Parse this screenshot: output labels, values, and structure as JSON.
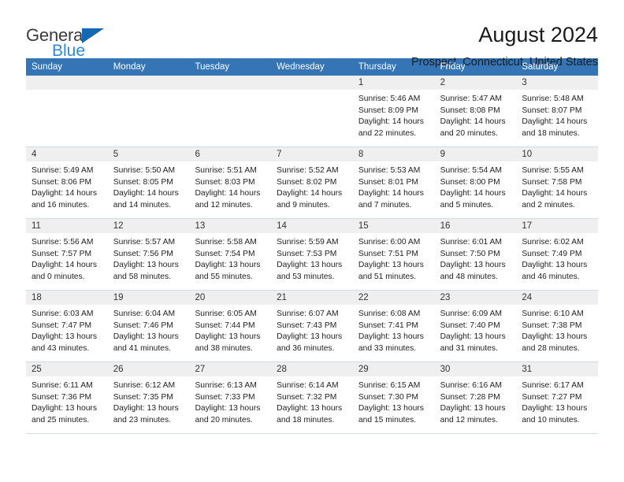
{
  "brand": {
    "name_part1": "General",
    "name_part2": "Blue"
  },
  "header": {
    "title": "August 2024",
    "subtitle": "Prospect, Connecticut, United States"
  },
  "weekday_headers": [
    "Sunday",
    "Monday",
    "Tuesday",
    "Wednesday",
    "Thursday",
    "Friday",
    "Saturday"
  ],
  "colors": {
    "header_blue": "#3575b6",
    "brand_blue": "#2e8ad6",
    "triangle_blue": "#1268b3",
    "daynum_band": "#efefef",
    "grid_line": "#cfdcea"
  },
  "labels": {
    "sunrise_prefix": "Sunrise: ",
    "sunset_prefix": "Sunset: ",
    "daylight_prefix": "Daylight: "
  },
  "weeks": [
    [
      {
        "day": "",
        "empty": true
      },
      {
        "day": "",
        "empty": true
      },
      {
        "day": "",
        "empty": true
      },
      {
        "day": "",
        "empty": true
      },
      {
        "day": "1",
        "sunrise": "Sunrise: 5:46 AM",
        "sunset": "Sunset: 8:09 PM",
        "daylight1": "Daylight: 14 hours",
        "daylight2": "and 22 minutes."
      },
      {
        "day": "2",
        "sunrise": "Sunrise: 5:47 AM",
        "sunset": "Sunset: 8:08 PM",
        "daylight1": "Daylight: 14 hours",
        "daylight2": "and 20 minutes."
      },
      {
        "day": "3",
        "sunrise": "Sunrise: 5:48 AM",
        "sunset": "Sunset: 8:07 PM",
        "daylight1": "Daylight: 14 hours",
        "daylight2": "and 18 minutes."
      }
    ],
    [
      {
        "day": "4",
        "sunrise": "Sunrise: 5:49 AM",
        "sunset": "Sunset: 8:06 PM",
        "daylight1": "Daylight: 14 hours",
        "daylight2": "and 16 minutes."
      },
      {
        "day": "5",
        "sunrise": "Sunrise: 5:50 AM",
        "sunset": "Sunset: 8:05 PM",
        "daylight1": "Daylight: 14 hours",
        "daylight2": "and 14 minutes."
      },
      {
        "day": "6",
        "sunrise": "Sunrise: 5:51 AM",
        "sunset": "Sunset: 8:03 PM",
        "daylight1": "Daylight: 14 hours",
        "daylight2": "and 12 minutes."
      },
      {
        "day": "7",
        "sunrise": "Sunrise: 5:52 AM",
        "sunset": "Sunset: 8:02 PM",
        "daylight1": "Daylight: 14 hours",
        "daylight2": "and 9 minutes."
      },
      {
        "day": "8",
        "sunrise": "Sunrise: 5:53 AM",
        "sunset": "Sunset: 8:01 PM",
        "daylight1": "Daylight: 14 hours",
        "daylight2": "and 7 minutes."
      },
      {
        "day": "9",
        "sunrise": "Sunrise: 5:54 AM",
        "sunset": "Sunset: 8:00 PM",
        "daylight1": "Daylight: 14 hours",
        "daylight2": "and 5 minutes."
      },
      {
        "day": "10",
        "sunrise": "Sunrise: 5:55 AM",
        "sunset": "Sunset: 7:58 PM",
        "daylight1": "Daylight: 14 hours",
        "daylight2": "and 2 minutes."
      }
    ],
    [
      {
        "day": "11",
        "sunrise": "Sunrise: 5:56 AM",
        "sunset": "Sunset: 7:57 PM",
        "daylight1": "Daylight: 14 hours",
        "daylight2": "and 0 minutes."
      },
      {
        "day": "12",
        "sunrise": "Sunrise: 5:57 AM",
        "sunset": "Sunset: 7:56 PM",
        "daylight1": "Daylight: 13 hours",
        "daylight2": "and 58 minutes."
      },
      {
        "day": "13",
        "sunrise": "Sunrise: 5:58 AM",
        "sunset": "Sunset: 7:54 PM",
        "daylight1": "Daylight: 13 hours",
        "daylight2": "and 55 minutes."
      },
      {
        "day": "14",
        "sunrise": "Sunrise: 5:59 AM",
        "sunset": "Sunset: 7:53 PM",
        "daylight1": "Daylight: 13 hours",
        "daylight2": "and 53 minutes."
      },
      {
        "day": "15",
        "sunrise": "Sunrise: 6:00 AM",
        "sunset": "Sunset: 7:51 PM",
        "daylight1": "Daylight: 13 hours",
        "daylight2": "and 51 minutes."
      },
      {
        "day": "16",
        "sunrise": "Sunrise: 6:01 AM",
        "sunset": "Sunset: 7:50 PM",
        "daylight1": "Daylight: 13 hours",
        "daylight2": "and 48 minutes."
      },
      {
        "day": "17",
        "sunrise": "Sunrise: 6:02 AM",
        "sunset": "Sunset: 7:49 PM",
        "daylight1": "Daylight: 13 hours",
        "daylight2": "and 46 minutes."
      }
    ],
    [
      {
        "day": "18",
        "sunrise": "Sunrise: 6:03 AM",
        "sunset": "Sunset: 7:47 PM",
        "daylight1": "Daylight: 13 hours",
        "daylight2": "and 43 minutes."
      },
      {
        "day": "19",
        "sunrise": "Sunrise: 6:04 AM",
        "sunset": "Sunset: 7:46 PM",
        "daylight1": "Daylight: 13 hours",
        "daylight2": "and 41 minutes."
      },
      {
        "day": "20",
        "sunrise": "Sunrise: 6:05 AM",
        "sunset": "Sunset: 7:44 PM",
        "daylight1": "Daylight: 13 hours",
        "daylight2": "and 38 minutes."
      },
      {
        "day": "21",
        "sunrise": "Sunrise: 6:07 AM",
        "sunset": "Sunset: 7:43 PM",
        "daylight1": "Daylight: 13 hours",
        "daylight2": "and 36 minutes."
      },
      {
        "day": "22",
        "sunrise": "Sunrise: 6:08 AM",
        "sunset": "Sunset: 7:41 PM",
        "daylight1": "Daylight: 13 hours",
        "daylight2": "and 33 minutes."
      },
      {
        "day": "23",
        "sunrise": "Sunrise: 6:09 AM",
        "sunset": "Sunset: 7:40 PM",
        "daylight1": "Daylight: 13 hours",
        "daylight2": "and 31 minutes."
      },
      {
        "day": "24",
        "sunrise": "Sunrise: 6:10 AM",
        "sunset": "Sunset: 7:38 PM",
        "daylight1": "Daylight: 13 hours",
        "daylight2": "and 28 minutes."
      }
    ],
    [
      {
        "day": "25",
        "sunrise": "Sunrise: 6:11 AM",
        "sunset": "Sunset: 7:36 PM",
        "daylight1": "Daylight: 13 hours",
        "daylight2": "and 25 minutes."
      },
      {
        "day": "26",
        "sunrise": "Sunrise: 6:12 AM",
        "sunset": "Sunset: 7:35 PM",
        "daylight1": "Daylight: 13 hours",
        "daylight2": "and 23 minutes."
      },
      {
        "day": "27",
        "sunrise": "Sunrise: 6:13 AM",
        "sunset": "Sunset: 7:33 PM",
        "daylight1": "Daylight: 13 hours",
        "daylight2": "and 20 minutes."
      },
      {
        "day": "28",
        "sunrise": "Sunrise: 6:14 AM",
        "sunset": "Sunset: 7:32 PM",
        "daylight1": "Daylight: 13 hours",
        "daylight2": "and 18 minutes."
      },
      {
        "day": "29",
        "sunrise": "Sunrise: 6:15 AM",
        "sunset": "Sunset: 7:30 PM",
        "daylight1": "Daylight: 13 hours",
        "daylight2": "and 15 minutes."
      },
      {
        "day": "30",
        "sunrise": "Sunrise: 6:16 AM",
        "sunset": "Sunset: 7:28 PM",
        "daylight1": "Daylight: 13 hours",
        "daylight2": "and 12 minutes."
      },
      {
        "day": "31",
        "sunrise": "Sunrise: 6:17 AM",
        "sunset": "Sunset: 7:27 PM",
        "daylight1": "Daylight: 13 hours",
        "daylight2": "and 10 minutes."
      }
    ]
  ]
}
